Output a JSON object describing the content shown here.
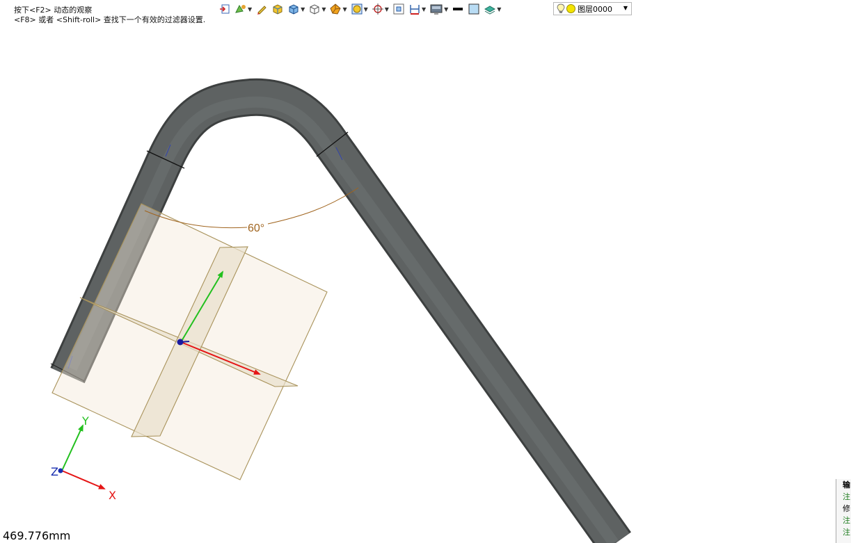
{
  "hint": {
    "line1": "按下<F2> 动态的观察",
    "line2": "<F8> 或者 <Shift-roll> 查找下一个有效的过滤器设置."
  },
  "toolbar": {
    "icons": [
      "exit-sketch-icon",
      "sketch-settings-icon",
      "pencil-icon",
      "box-3d-icon",
      "view-cube-icon",
      "wireframe-cube-icon",
      "render-style-icon",
      "appearance-icon",
      "snap-target-icon",
      "zoom-fit-icon",
      "dimension-icon",
      "display-icon",
      "line-color-icon",
      "fill-color-icon",
      "layer-stack-icon"
    ],
    "layer_value": "图层0000"
  },
  "viewport": {
    "angle_label": "60°",
    "axis_x": "X",
    "axis_y": "Y",
    "axis_z": "Z"
  },
  "status": {
    "measure": "469.776mm"
  },
  "side_panel": {
    "items": [
      "输",
      "注",
      "修",
      "注",
      "注"
    ]
  },
  "colors": {
    "pipe": "#5a5e5e",
    "dimension": "#a0641e",
    "axis_x": "#e51414",
    "axis_y": "#22c01e",
    "axis_z": "#1a2fb0"
  }
}
